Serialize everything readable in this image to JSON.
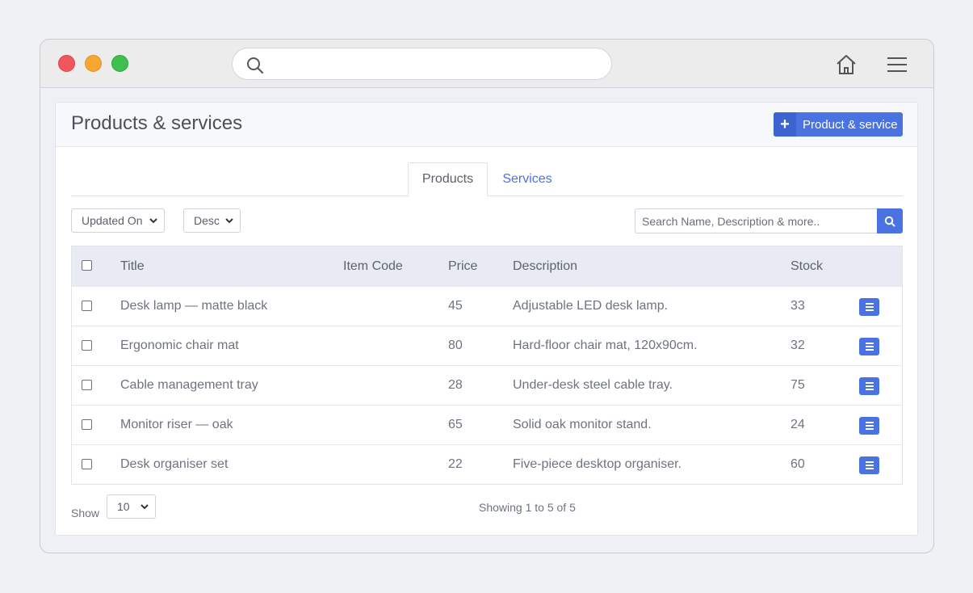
{
  "browser": {
    "controls": [
      "close",
      "minimize",
      "maximize"
    ],
    "icons": [
      "search-icon",
      "home-icon",
      "hamburger-menu-icon"
    ]
  },
  "header": {
    "title": "Products & services",
    "add_button_label": "Product & service"
  },
  "tabs": [
    {
      "label": "Products",
      "active": true
    },
    {
      "label": "Services",
      "active": false
    }
  ],
  "filters": {
    "sort_by": "Updated On",
    "sort_dir": "Desc",
    "search_placeholder": "Search Name, Description & more.."
  },
  "table": {
    "columns": [
      "Title",
      "Item Code",
      "Price",
      "Description",
      "Stock"
    ],
    "rows": [
      {
        "title": "Desk lamp — matte black",
        "item_code": "",
        "price": "45",
        "description": "Adjustable LED desk lamp.",
        "stock": "33"
      },
      {
        "title": "Ergonomic chair mat",
        "item_code": "",
        "price": "80",
        "description": "Hard-floor chair mat, 120x90cm.",
        "stock": "32"
      },
      {
        "title": "Cable management tray",
        "item_code": "",
        "price": "28",
        "description": "Under-desk steel cable tray.",
        "stock": "75"
      },
      {
        "title": "Monitor riser — oak",
        "item_code": "",
        "price": "65",
        "description": "Solid oak monitor stand.",
        "stock": "24"
      },
      {
        "title": "Desk organiser set",
        "item_code": "",
        "price": "22",
        "description": "Five-piece desktop organiser.",
        "stock": "60"
      }
    ]
  },
  "footer": {
    "show_label": "Show",
    "page_size": "10",
    "showing_text": "Showing 1 to 5 of 5"
  },
  "colors": {
    "accent": "#4a72e0",
    "header_row": "#e8ebf3"
  }
}
